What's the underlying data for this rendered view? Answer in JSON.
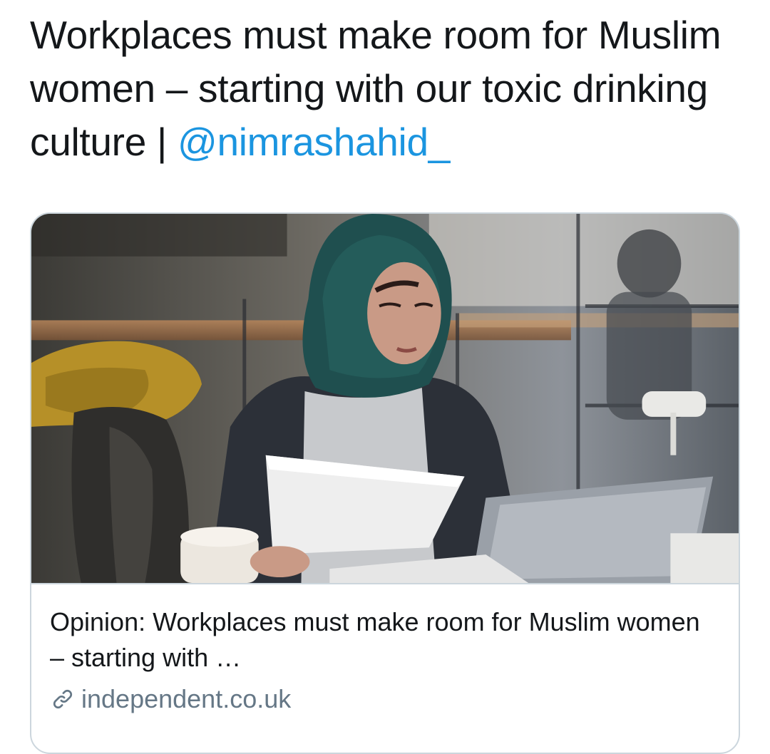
{
  "tweet": {
    "text_before_mention": "Workplaces must make room for Muslim women – starting with our toxic drinking culture | ",
    "mention": "@nimrashahid_"
  },
  "card": {
    "image_alt": "Woman in hijab reading papers in a cafe, seen through a window",
    "title": "Opinion: Workplaces must make room for Muslim women – starting with …",
    "domain": "independent.co.uk",
    "domain_icon": "link-icon"
  },
  "colors": {
    "mention": "#1b95e0",
    "text": "#14171a",
    "muted": "#657786",
    "border": "#ccd6dd"
  }
}
